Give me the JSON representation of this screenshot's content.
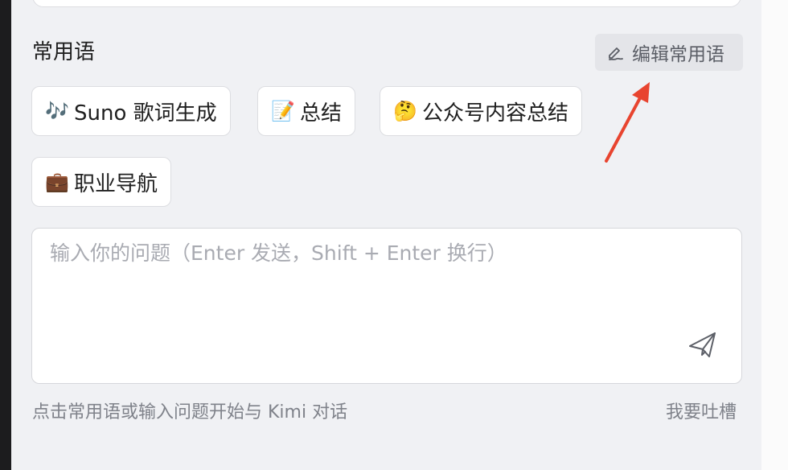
{
  "section": {
    "title": "常用语",
    "edit_label": "编辑常用语"
  },
  "phrases": [
    {
      "emoji": "🎶",
      "label": "Suno 歌词生成"
    },
    {
      "emoji": "📝",
      "label": "总结"
    },
    {
      "emoji": "🤔",
      "label": "公众号内容总结"
    },
    {
      "emoji": "💼",
      "label": "职业导航"
    }
  ],
  "input": {
    "placeholder": "输入你的问题（Enter 发送，Shift + Enter 换行）",
    "value": ""
  },
  "footer": {
    "hint": "点击常用语或输入问题开始与 Kimi 对话",
    "feedback": "我要吐槽"
  },
  "colors": {
    "annotation_arrow": "#e8442f",
    "background": "#f0f1f4"
  }
}
